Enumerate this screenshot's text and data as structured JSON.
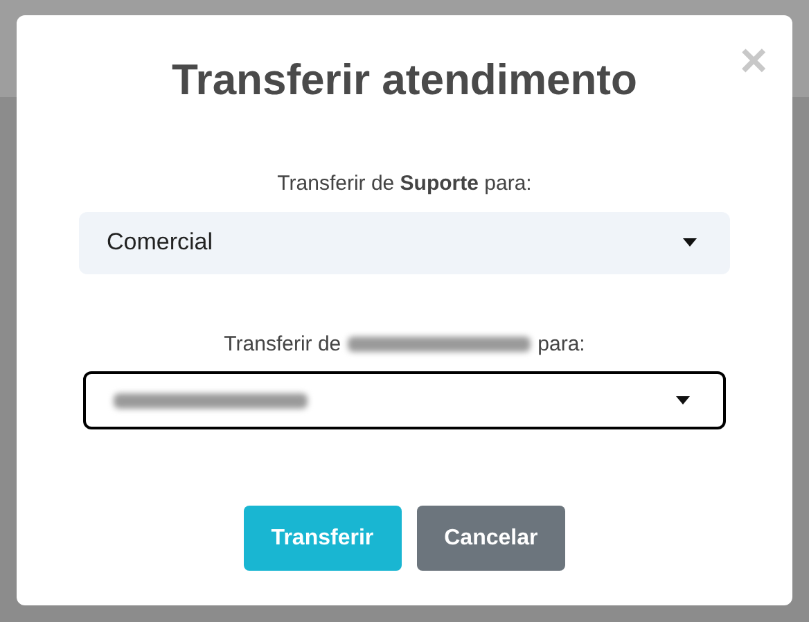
{
  "dialog": {
    "title": "Transferir atendimento",
    "close": "×",
    "fields": [
      {
        "label": "Transferir de **Suporte** para:",
        "value": "Comercial",
        "focused": false
      },
      {
        "label_before": "Transferir de",
        "label_after": "para:",
        "redacted": true,
        "focused": true
      }
    ],
    "buttons": [
      {
        "label": "Transferir",
        "kind": "primary"
      },
      {
        "label": "Cancelar",
        "kind": "secondary"
      }
    ]
  }
}
